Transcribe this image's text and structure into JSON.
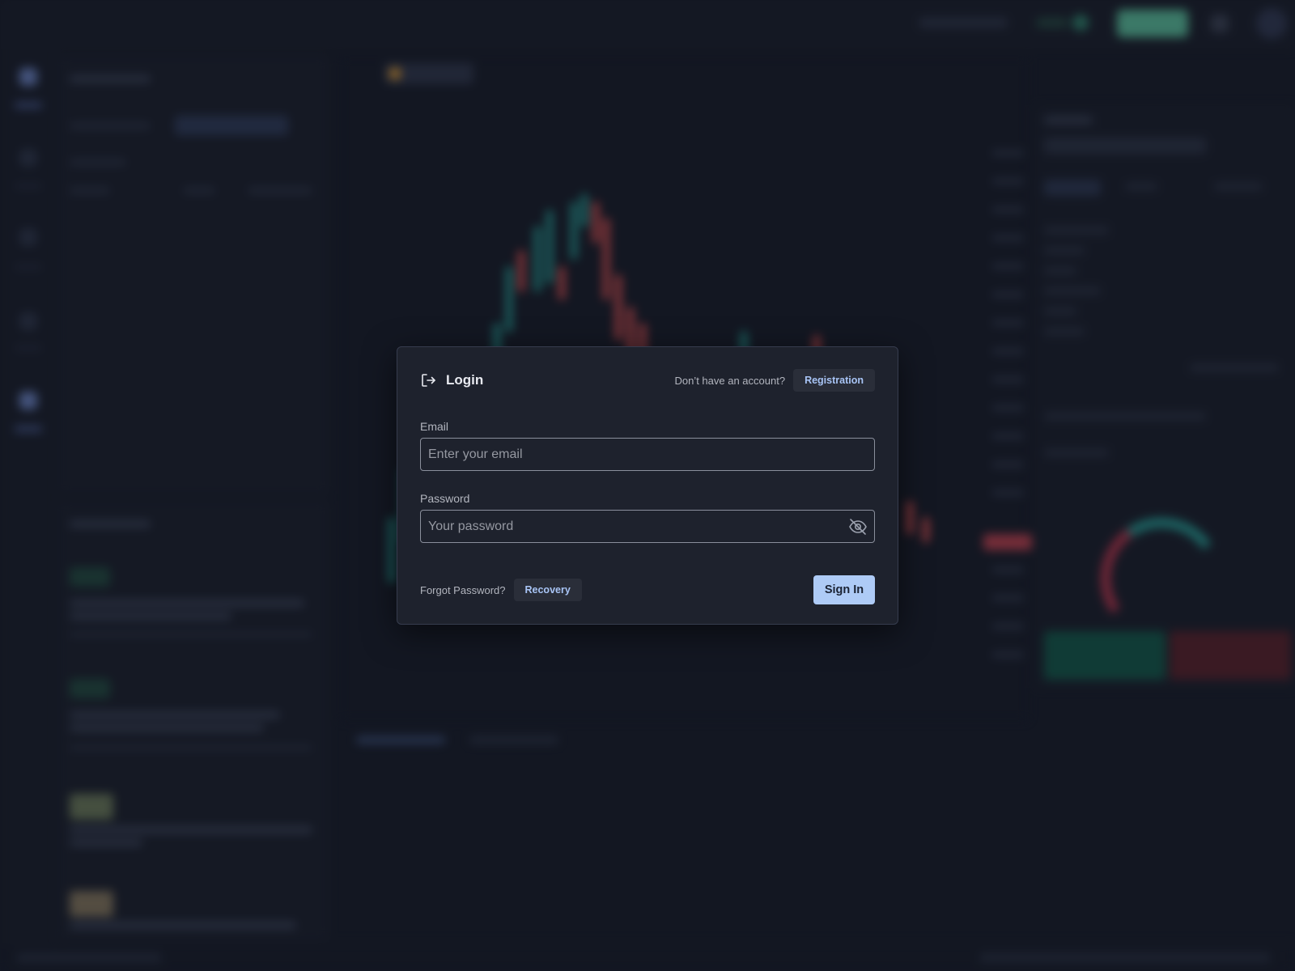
{
  "modal": {
    "title": "Login",
    "no_account_text": "Don’t have an account?",
    "registration_label": "Registration",
    "email_label": "Email",
    "email_placeholder": "Enter your email",
    "email_value": "",
    "password_label": "Password",
    "password_placeholder": "Your password",
    "password_value": "",
    "forgot_text": "Forgot Password?",
    "recovery_label": "Recovery",
    "sign_in_label": "Sign In",
    "icons": {
      "title": "login-icon",
      "password_toggle": "eye-off-icon"
    }
  },
  "colors": {
    "background": "#131722",
    "modal_bg": "#1e222d",
    "accent_button": "#aecbf6",
    "link_text": "#a8c4f5",
    "candle_up": "#26a69a",
    "candle_down": "#ef5350"
  }
}
